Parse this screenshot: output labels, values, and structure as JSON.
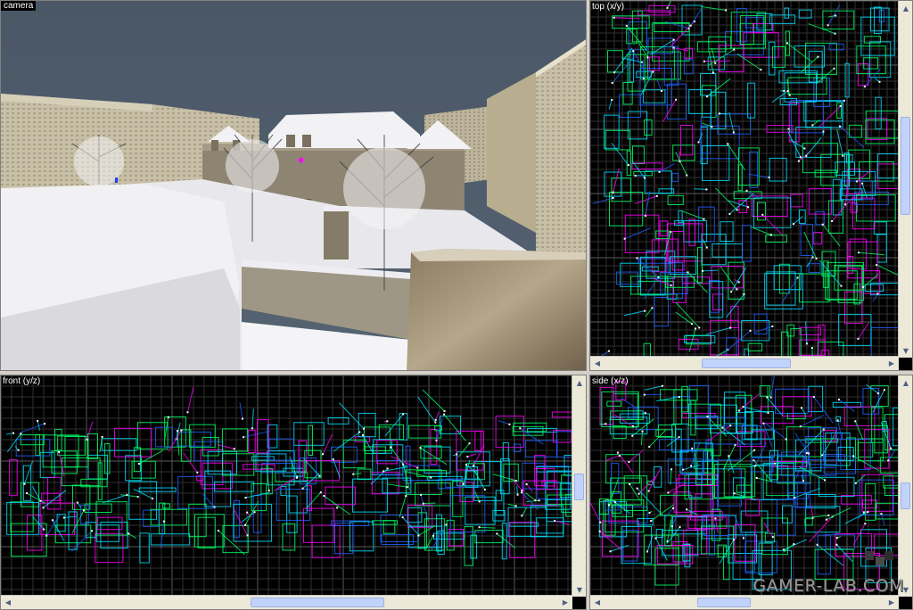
{
  "viewports": {
    "camera": {
      "label": "camera"
    },
    "top": {
      "label": "top (x/y)"
    },
    "front": {
      "label": "front (y/z)"
    },
    "side": {
      "label": "side (x/z)"
    }
  },
  "scroll_arrows": {
    "up": "▲",
    "down": "▼",
    "left": "◀",
    "right": "▶"
  },
  "watermark": {
    "text": "GAMER-LAB.COM"
  },
  "colors": {
    "grid_minor": "#303030",
    "grid_major": "#5a5a5a",
    "brush_green": "#00ff66",
    "brush_cyan": "#00e0ff",
    "brush_magenta": "#ff00ff",
    "brush_blue": "#2060ff",
    "sky": "#4a5766",
    "snow": "#e8e8ec"
  }
}
